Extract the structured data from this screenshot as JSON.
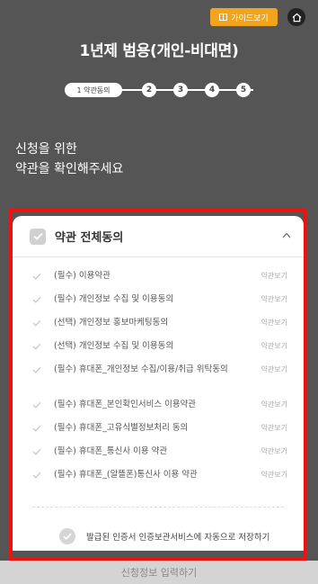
{
  "header": {
    "guide_label": "가이드보기",
    "title": "1년제 범용(개인-비대면)"
  },
  "stepper": {
    "current_label": "1 약관동의",
    "steps": [
      "2",
      "3",
      "4",
      "5"
    ]
  },
  "intro": {
    "line1": "신청을 위한",
    "line2": "약관을 확인해주세요"
  },
  "card": {
    "title": "약관 전체동의",
    "view_label": "약관보기",
    "items": [
      {
        "label": "(필수) 이용약관"
      },
      {
        "label": "(필수) 개인정보 수집 및 이용동의"
      },
      {
        "label": "(선택) 개인정보 홍보마케팅동의"
      },
      {
        "label": "(선택) 개인정보 수집 및 이용동의"
      },
      {
        "label": "(필수) 휴대폰_개인정보 수집/이용/취급 위탁동의"
      },
      {
        "label": "(필수) 휴대폰_본인확인서비스 이용약관"
      },
      {
        "label": "(필수) 휴대폰_고유식별정보처리 동의"
      },
      {
        "label": "(필수) 휴대폰_통신사 이용 약관"
      },
      {
        "label": "(필수) 휴대폰_(알뜰폰)통신사 이용 약관"
      }
    ],
    "save_label": "발급된 인증서 인증보관서비스에 자동으로 저장하기"
  },
  "footer": {
    "submit_label": "신청정보 입력하기"
  },
  "colors": {
    "background": "#555555",
    "accent": "#f2a41f",
    "highlight": "#ee1111"
  }
}
